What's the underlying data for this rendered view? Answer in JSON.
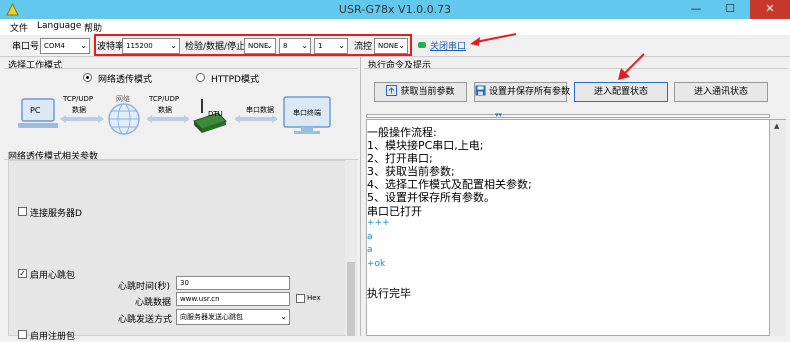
{
  "window": {
    "title": "USR-G78x V1.0.0.73",
    "minimize": "—",
    "maximize": "☐",
    "close": "✕"
  },
  "menu": [
    "文件",
    "Language",
    "帮助"
  ],
  "toolbar": {
    "port_label": "串口号",
    "port_value": "COM4",
    "baud_label": "波特率",
    "baud_value": "115200",
    "parity_label": "检验/数据/停止",
    "parity_value": "NONE",
    "data_value": "8",
    "stop_value": "1",
    "flow_label": "流控",
    "flow_value": "NONE",
    "close_port_label": "关闭串口"
  },
  "left": {
    "work_mode_title": "选择工作模式",
    "modes": [
      "网络透传模式",
      "HTTPD模式"
    ],
    "diagram": {
      "pc": "PC",
      "tcpudp": "TCP/UDP",
      "data": "数据",
      "network": "网络",
      "dtu": "DTU",
      "serial_data": "串口数据",
      "serial_terminal": "串口终端"
    },
    "params_title": "网络透传模式相关参数",
    "connect_server_label": "连接服务器D",
    "heartbeat_enable_label": "启用心跳包",
    "heartbeat_time_label": "心跳时间(秒)",
    "heartbeat_time_value": "30",
    "heartbeat_data_label": "心跳数据",
    "heartbeat_data_value": "www.usr.cn",
    "hex_label": "Hex",
    "heartbeat_mode_label": "心跳发送方式",
    "heartbeat_mode_value": "向服务器发送心跳包",
    "cutoff_label": "启用注册包"
  },
  "right": {
    "title": "执行命令及提示",
    "buttons": [
      "获取当前参数",
      "设置并保存所有参数",
      "进入配置状态",
      "进入通讯状态"
    ],
    "log": [
      {
        "text": "一般操作流程:",
        "color": "black"
      },
      {
        "text": "1、模块接PC串口,上电;",
        "color": "black"
      },
      {
        "text": "2、打开串口;",
        "color": "black"
      },
      {
        "text": "3、获取当前参数;",
        "color": "black"
      },
      {
        "text": "4、选择工作模式及配置相关参数;",
        "color": "black"
      },
      {
        "text": "5、设置并保存所有参数。",
        "color": "black"
      },
      {
        "text": "串口已打开",
        "color": "black"
      },
      {
        "text": "+++",
        "color": "blue"
      },
      {
        "text": "a",
        "color": "blue"
      },
      {
        "text": "a",
        "color": "blue"
      },
      {
        "text": "+ok",
        "color": "blue"
      },
      {
        "text": "",
        "color": "black"
      },
      {
        "text": "执行完毕",
        "color": "black"
      }
    ]
  },
  "colors": {
    "titlebar": "#62c8ee",
    "annotation_red": "#e02020",
    "status_green": "#22b14c",
    "log_blue": "#1a8fc0"
  }
}
